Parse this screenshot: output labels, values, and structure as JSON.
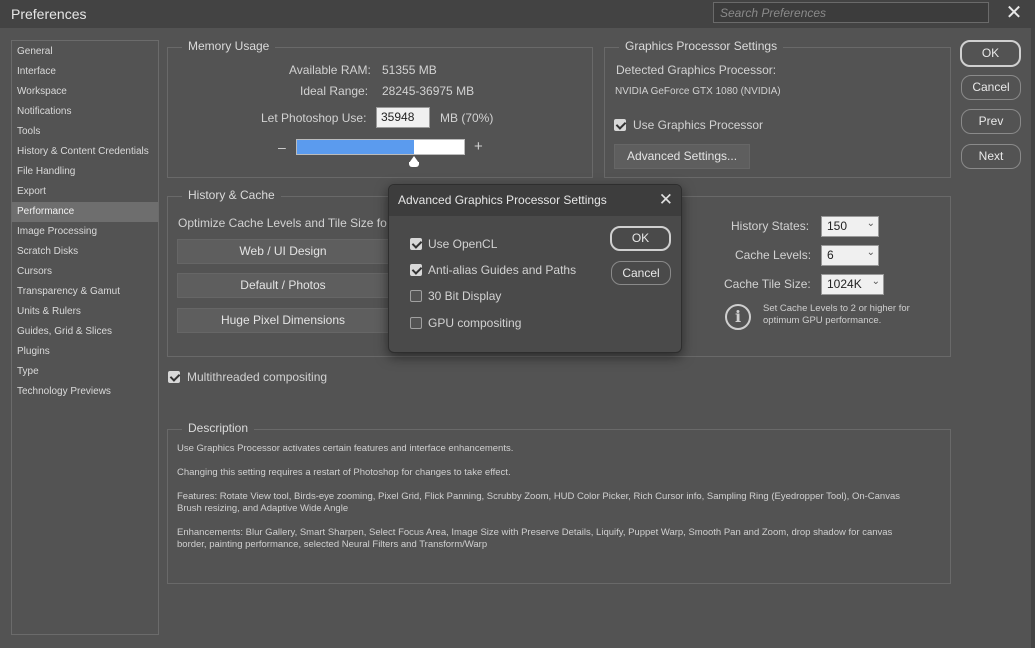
{
  "window": {
    "title": "Preferences",
    "search_placeholder": "Search Preferences",
    "close": "✕"
  },
  "sidebar": {
    "items": [
      {
        "label": "General"
      },
      {
        "label": "Interface"
      },
      {
        "label": "Workspace"
      },
      {
        "label": "Notifications"
      },
      {
        "label": "Tools"
      },
      {
        "label": "History & Content Credentials"
      },
      {
        "label": "File Handling"
      },
      {
        "label": "Export"
      },
      {
        "label": "Performance"
      },
      {
        "label": "Image Processing"
      },
      {
        "label": "Scratch Disks"
      },
      {
        "label": "Cursors"
      },
      {
        "label": "Transparency & Gamut"
      },
      {
        "label": "Units & Rulers"
      },
      {
        "label": "Guides, Grid & Slices"
      },
      {
        "label": "Plugins"
      },
      {
        "label": "Type"
      },
      {
        "label": "Technology Previews"
      }
    ],
    "selected": "Performance"
  },
  "memory": {
    "title": "Memory Usage",
    "available_label": "Available RAM:",
    "available_value": "51355 MB",
    "ideal_label": "Ideal Range:",
    "ideal_value": "28245-36975 MB",
    "let_label": "Let Photoshop Use:",
    "let_value": "35948",
    "let_suffix": "MB (70%)",
    "minus": "–",
    "plus": "+",
    "slider_fraction": 0.7
  },
  "gpu": {
    "title": "Graphics Processor Settings",
    "detected_label": "Detected Graphics Processor:",
    "detected_value": "NVIDIA GeForce GTX 1080 (NVIDIA)",
    "use_label": "Use Graphics Processor",
    "use_checked": true,
    "advanced_button": "Advanced Settings..."
  },
  "history": {
    "title": "History & Cache",
    "optimize_label": "Optimize Cache Levels and Tile Size fo",
    "buttons": [
      "Web / UI Design",
      "Default / Photos",
      "Huge Pixel Dimensions"
    ],
    "states_label": "History States:",
    "states_value": "150",
    "levels_label": "Cache Levels:",
    "levels_value": "6",
    "tile_label": "Cache Tile Size:",
    "tile_value": "1024K",
    "note": "Set Cache Levels to 2 or higher for optimum GPU performance."
  },
  "multithreaded": {
    "label": "Multithreaded compositing",
    "checked": true
  },
  "description": {
    "title": "Description",
    "p1": "Use Graphics Processor activates certain features and interface enhancements.",
    "p2": "Changing this setting requires a restart of Photoshop for changes to take effect.",
    "p3": "Features: Rotate View tool, Birds-eye zooming, Pixel Grid, Flick Panning, Scrubby Zoom, HUD Color Picker, Rich Cursor info, Sampling Ring (Eyedropper Tool), On-Canvas Brush resizing, and Adaptive Wide Angle",
    "p4": "Enhancements: Blur Gallery, Smart Sharpen, Select Focus Area, Image Size with Preserve Details, Liquify, Puppet Warp, Smooth Pan and Zoom, drop shadow for canvas border, painting performance, selected Neural Filters and Transform/Warp"
  },
  "actions": {
    "ok": "OK",
    "cancel": "Cancel",
    "prev": "Prev",
    "next": "Next"
  },
  "dialog": {
    "title": "Advanced Graphics Processor Settings",
    "close": "✕",
    "options": [
      {
        "label": "Use OpenCL",
        "checked": true
      },
      {
        "label": "Anti-alias Guides and Paths",
        "checked": true
      },
      {
        "label": "30 Bit Display",
        "checked": false
      },
      {
        "label": "GPU compositing",
        "checked": false
      }
    ],
    "ok": "OK",
    "cancel": "Cancel"
  },
  "chevron": "⌄"
}
